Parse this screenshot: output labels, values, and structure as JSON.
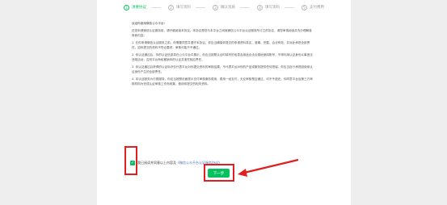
{
  "steps": [
    {
      "num": "1",
      "label": "须要协议"
    },
    {
      "num": "2",
      "label": "填写资料"
    },
    {
      "num": "3",
      "label": "确认资质"
    },
    {
      "num": "4",
      "label": "填写资料"
    },
    {
      "num": "5",
      "label": "支付费用"
    }
  ],
  "agreement": {
    "greeting": "欢迎你使用微信公众平台!",
    "paragraphs": [
      "在您申请微信认证服务前，请仔细阅读本协议，本协议是您与本平台之间就微信公众平台认证服务所订立的协议，请您审慎阅读并充分理解各条款内容。",
      "1. 在你申请微信认证服务之前，你需要同意并遵守本协议，你应当确保你提交的申请资料真实、准确、完整、合法有效，并对此承担全部责任，如你提交的资料不符合要求，审核可能不予通过。",
      "2. 你认证通过后，你的认证信息将在公众平台中展示，你应当按照认证时填写的信息及用途合法合规地使用账号，不得利用认证身份从事违法违规活动，否则平台有权撤销你的认证并追究相应责任。",
      "3. 你认证通过后获得的认证标识仅代表平台对你提交资料的审核结果，不代表平台对你的产品或服务提供任何担保，你应当自行承担因使用认证身份产生的全部责任。",
      "4. 本认证服务为付费服务，你应当按照页面提示支付审核服务费用，费用一经支付，无论审核是否通过，均不予退还。你同意平台及第三方审核机构为完成认证审核工作而收集、使用你提交的相关资料。"
    ]
  },
  "agree": {
    "text": "我已阅读并同意以上内容及",
    "link": "《微信公众平台认证服务协议》"
  },
  "next_button": "下一步",
  "colors": {
    "accent": "#07c160",
    "highlight": "#e02020"
  }
}
